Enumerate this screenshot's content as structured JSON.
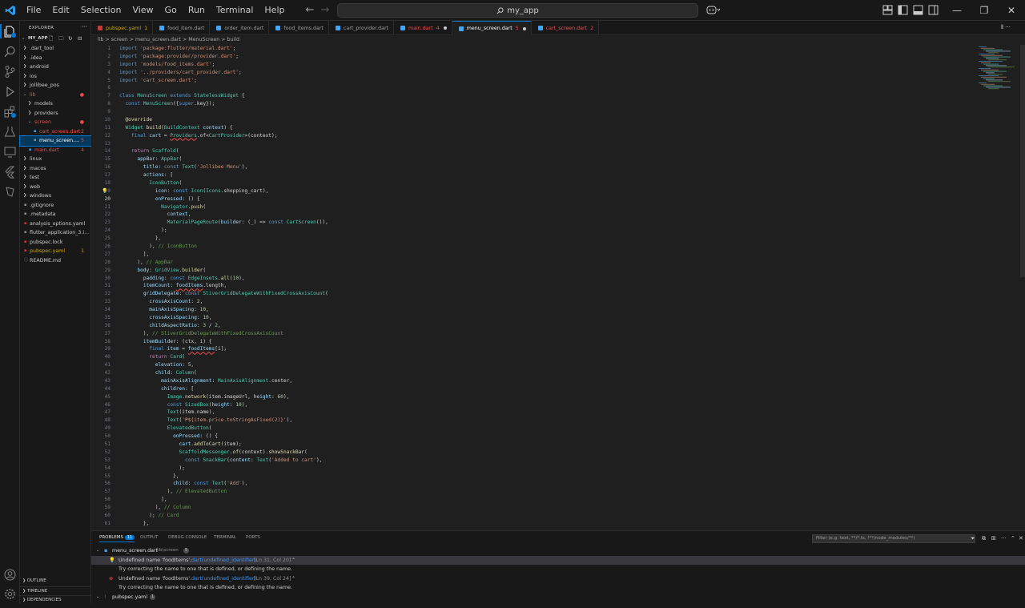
{
  "menu": [
    "File",
    "Edit",
    "Selection",
    "View",
    "Go",
    "Run",
    "Terminal",
    "Help"
  ],
  "search": {
    "text": "my_app"
  },
  "explorer": {
    "title": "EXPLORER",
    "project": "MY_APP",
    "items": [
      {
        "label": ".dart_tool",
        "depth": 1,
        "kind": "folder",
        "badge": "",
        "color": "#cccccc"
      },
      {
        "label": ".idea",
        "depth": 1,
        "kind": "folder",
        "badge": "",
        "color": "#cccccc"
      },
      {
        "label": "android",
        "depth": 1,
        "kind": "folder",
        "badge": "",
        "color": "#cccccc"
      },
      {
        "label": "ios",
        "depth": 1,
        "kind": "folder",
        "badge": "",
        "color": "#cccccc"
      },
      {
        "label": "jollibee_pos",
        "depth": 1,
        "kind": "folder",
        "badge": "",
        "color": "#cccccc"
      },
      {
        "label": "lib",
        "depth": 1,
        "kind": "open",
        "badge": "●",
        "color": "#f14c4c"
      },
      {
        "label": "models",
        "depth": 2,
        "kind": "folder",
        "badge": "",
        "color": "#cccccc"
      },
      {
        "label": "providers",
        "depth": 2,
        "kind": "folder",
        "badge": "",
        "color": "#cccccc"
      },
      {
        "label": "screen",
        "depth": 2,
        "kind": "open",
        "badge": "●",
        "color": "#f14c4c"
      },
      {
        "label": "cart_screen.dart",
        "depth": 3,
        "kind": "file",
        "badge": "2",
        "color": "#f14c4c"
      },
      {
        "label": "menu_screen....",
        "depth": 3,
        "kind": "file",
        "badge": "5",
        "color": "#ffffff"
      },
      {
        "label": "main.dart",
        "depth": 2,
        "kind": "file",
        "badge": "4",
        "color": "#f14c4c"
      },
      {
        "label": "linux",
        "depth": 1,
        "kind": "folder",
        "badge": "",
        "color": "#cccccc"
      },
      {
        "label": "macos",
        "depth": 1,
        "kind": "folder",
        "badge": "",
        "color": "#cccccc"
      },
      {
        "label": "test",
        "depth": 1,
        "kind": "folder",
        "badge": "",
        "color": "#cccccc"
      },
      {
        "label": "web",
        "depth": 1,
        "kind": "folder",
        "badge": "",
        "color": "#cccccc"
      },
      {
        "label": "windows",
        "depth": 1,
        "kind": "folder",
        "badge": "",
        "color": "#cccccc"
      },
      {
        "label": ".gitignore",
        "depth": 1,
        "kind": "file",
        "badge": "",
        "color": "#cccccc"
      },
      {
        "label": ".metadata",
        "depth": 1,
        "kind": "file",
        "badge": "",
        "color": "#cccccc"
      },
      {
        "label": "analysis_options.yaml",
        "depth": 1,
        "kind": "file",
        "badge": "",
        "color": "#cccccc"
      },
      {
        "label": "flutter_application_3.i...",
        "depth": 1,
        "kind": "file",
        "badge": "",
        "color": "#cccccc"
      },
      {
        "label": "pubspec.lock",
        "depth": 1,
        "kind": "file",
        "badge": "",
        "color": "#cccccc"
      },
      {
        "label": "pubspec.yaml",
        "depth": 1,
        "kind": "file",
        "badge": "1",
        "color": "#cca700"
      },
      {
        "label": "README.md",
        "depth": 1,
        "kind": "file",
        "badge": "",
        "color": "#cccccc"
      }
    ],
    "bottom": [
      "OUTLINE",
      "TIMELINE",
      "DEPENDENCIES"
    ]
  },
  "tabs": [
    {
      "label": "pubspec.yaml",
      "badge": "1",
      "color": "#cca700",
      "icon": "#cb3837",
      "active": false,
      "dirty": false
    },
    {
      "label": "food_item.dart",
      "badge": "",
      "color": "#9d9d9d",
      "icon": "#42a5f5",
      "active": false,
      "dirty": false
    },
    {
      "label": "order_item.dart",
      "badge": "",
      "color": "#9d9d9d",
      "icon": "#42a5f5",
      "active": false,
      "dirty": false
    },
    {
      "label": "food_items.dart",
      "badge": "",
      "color": "#9d9d9d",
      "icon": "#42a5f5",
      "active": false,
      "dirty": false
    },
    {
      "label": "cart_provider.dart",
      "badge": "",
      "color": "#9d9d9d",
      "icon": "#42a5f5",
      "active": false,
      "dirty": false
    },
    {
      "label": "main.dart",
      "badge": "4",
      "color": "#f14c4c",
      "icon": "#42a5f5",
      "active": false,
      "dirty": true
    },
    {
      "label": "menu_screen.dart",
      "badge": "5",
      "color": "#f14c4c",
      "icon": "#42a5f5",
      "active": true,
      "dirty": true
    },
    {
      "label": "cart_screen.dart",
      "badge": "2",
      "color": "#f14c4c",
      "icon": "#42a5f5",
      "active": false,
      "dirty": false
    }
  ],
  "breadcrumb": "lib > screen > menu_screen.dart > MenuScreen > build",
  "current_line": 20,
  "code_lines": [
    [
      [
        "kw",
        "import "
      ],
      [
        "str",
        "'package:flutter/material.dart'"
      ],
      [
        "",
        "; "
      ]
    ],
    [
      [
        "kw",
        "import "
      ],
      [
        "str",
        "'package:provider/provider.dart'"
      ],
      [
        "",
        ";"
      ]
    ],
    [
      [
        "kw",
        "import "
      ],
      [
        "str",
        "'models/food_items.dart'"
      ],
      [
        "",
        ";"
      ]
    ],
    [
      [
        "kw",
        "import "
      ],
      [
        "str",
        "'../providers/cart_provider.dart'"
      ],
      [
        "",
        ";"
      ]
    ],
    [
      [
        "kw",
        "import "
      ],
      [
        "str",
        "'cart_screen.dart'"
      ],
      [
        "",
        ";"
      ]
    ],
    [],
    [
      [
        "kw",
        "class "
      ],
      [
        "cls",
        "MenuScreen "
      ],
      [
        "kw",
        "extends "
      ],
      [
        "cls",
        "StatelessWidget "
      ],
      [
        "",
        "{"
      ]
    ],
    [
      [
        "",
        "  "
      ],
      [
        "kw",
        "const "
      ],
      [
        "cls",
        "MenuScreen"
      ],
      [
        "",
        "({"
      ],
      [
        "kw",
        "super"
      ],
      [
        "",
        ".key});"
      ]
    ],
    [],
    [
      [
        "",
        "  "
      ],
      [
        "fn",
        "@override"
      ]
    ],
    [
      [
        "",
        "  "
      ],
      [
        "cls",
        "Widget "
      ],
      [
        "fn",
        "build"
      ],
      [
        "",
        "("
      ],
      [
        "cls",
        "BuildContext "
      ],
      [
        "var",
        "context"
      ],
      [
        "",
        ") {"
      ]
    ],
    [
      [
        "",
        "    "
      ],
      [
        "kw",
        "final "
      ],
      [
        "var",
        "cart "
      ],
      [
        "",
        "= "
      ],
      [
        "cls",
        "Providers"
      ],
      [
        "",
        ".of<"
      ],
      [
        "cls",
        "CartProvider"
      ],
      [
        "",
        ">(context);"
      ]
    ],
    [],
    [
      [
        "",
        "    "
      ],
      [
        "kw2",
        "return "
      ],
      [
        "cls",
        "Scaffold"
      ],
      [
        "",
        "("
      ]
    ],
    [
      [
        "",
        "      "
      ],
      [
        "var",
        "appBar"
      ],
      [
        "",
        ": "
      ],
      [
        "cls",
        "AppBar"
      ],
      [
        "",
        "("
      ]
    ],
    [
      [
        "",
        "        "
      ],
      [
        "var",
        "title"
      ],
      [
        "",
        ": "
      ],
      [
        "kw",
        "const "
      ],
      [
        "cls",
        "Text"
      ],
      [
        "",
        "("
      ],
      [
        "str",
        "'Jollibee Menu'"
      ],
      [
        "",
        "),"
      ]
    ],
    [
      [
        "",
        "        "
      ],
      [
        "var",
        "actions"
      ],
      [
        "",
        ": ["
      ]
    ],
    [
      [
        "",
        "          "
      ],
      [
        "cls",
        "IconButton"
      ],
      [
        "",
        "("
      ]
    ],
    [
      [
        "",
        "            "
      ],
      [
        "var",
        "icon"
      ],
      [
        "",
        ": "
      ],
      [
        "kw",
        "const "
      ],
      [
        "cls",
        "Icon"
      ],
      [
        "",
        "("
      ],
      [
        "cls",
        "Icons"
      ],
      [
        "",
        ".shopping_cart),"
      ]
    ],
    [
      [
        "",
        "            "
      ],
      [
        "var",
        "onPressed"
      ],
      [
        "",
        ": () {"
      ]
    ],
    [
      [
        "",
        "              "
      ],
      [
        "cls",
        "Navigator"
      ],
      [
        "",
        "."
      ],
      [
        "fn",
        "push"
      ],
      [
        "",
        "("
      ]
    ],
    [
      [
        "",
        "                "
      ],
      [
        "var",
        "context"
      ],
      [
        "",
        ","
      ]
    ],
    [
      [
        "",
        "                "
      ],
      [
        "cls",
        "MaterialPageRoute"
      ],
      [
        "",
        "("
      ],
      [
        "var",
        "builder"
      ],
      [
        "",
        ": (_) => "
      ],
      [
        "kw",
        "const "
      ],
      [
        "cls",
        "CartScreen"
      ],
      [
        "",
        "()),"
      ]
    ],
    [
      [
        "",
        "              );"
      ]
    ],
    [
      [
        "",
        "            },"
      ]
    ],
    [
      [
        "",
        "          ), "
      ],
      [
        "cmt",
        "// IconButton"
      ]
    ],
    [
      [
        "",
        "        ],"
      ]
    ],
    [
      [
        "",
        "      ), "
      ],
      [
        "cmt",
        "// AppBar"
      ]
    ],
    [
      [
        "",
        "      "
      ],
      [
        "var",
        "body"
      ],
      [
        "",
        ": "
      ],
      [
        "cls",
        "GridView"
      ],
      [
        "",
        "."
      ],
      [
        "fn",
        "builder"
      ],
      [
        "",
        "("
      ]
    ],
    [
      [
        "",
        "        "
      ],
      [
        "var",
        "padding"
      ],
      [
        "",
        ": "
      ],
      [
        "kw",
        "const "
      ],
      [
        "cls",
        "EdgeInsets"
      ],
      [
        "",
        "."
      ],
      [
        "fn",
        "all"
      ],
      [
        "",
        "("
      ],
      [
        "num",
        "10"
      ],
      [
        "",
        "),"
      ]
    ],
    [
      [
        "",
        "        "
      ],
      [
        "var",
        "itemCount"
      ],
      [
        "",
        ": "
      ],
      [
        "var",
        "foodItems"
      ],
      [
        "",
        ".length,"
      ]
    ],
    [
      [
        "",
        "        "
      ],
      [
        "var",
        "gridDelegate"
      ],
      [
        "",
        ": "
      ],
      [
        "kw",
        "const "
      ],
      [
        "cls",
        "SliverGridDelegateWithFixedCrossAxisCount"
      ],
      [
        "",
        "("
      ]
    ],
    [
      [
        "",
        "          "
      ],
      [
        "var",
        "crossAxisCount"
      ],
      [
        "",
        ": "
      ],
      [
        "num",
        "2"
      ],
      [
        "",
        ","
      ]
    ],
    [
      [
        "",
        "          "
      ],
      [
        "var",
        "mainAxisSpacing"
      ],
      [
        "",
        ": "
      ],
      [
        "num",
        "10"
      ],
      [
        "",
        ","
      ]
    ],
    [
      [
        "",
        "          "
      ],
      [
        "var",
        "crossAxisSpacing"
      ],
      [
        "",
        ": "
      ],
      [
        "num",
        "10"
      ],
      [
        "",
        ","
      ]
    ],
    [
      [
        "",
        "          "
      ],
      [
        "var",
        "childAspectRatio"
      ],
      [
        "",
        ": "
      ],
      [
        "num",
        "3 "
      ],
      [
        "",
        "/ "
      ],
      [
        "num",
        "2"
      ],
      [
        "",
        ","
      ]
    ],
    [
      [
        "",
        "        ), "
      ],
      [
        "cmt",
        "// SliverGridDelegateWithFixedCrossAxisCount"
      ]
    ],
    [
      [
        "",
        "        "
      ],
      [
        "var",
        "itemBuilder"
      ],
      [
        "",
        ": (ctx, i) {"
      ]
    ],
    [
      [
        "",
        "          "
      ],
      [
        "kw",
        "final "
      ],
      [
        "var",
        "item "
      ],
      [
        "",
        "= "
      ],
      [
        "var",
        "foodItems"
      ],
      [
        "",
        "[i];"
      ]
    ],
    [
      [
        "",
        "          "
      ],
      [
        "kw2",
        "return "
      ],
      [
        "cls",
        "Card"
      ],
      [
        "",
        "("
      ]
    ],
    [
      [
        "",
        "            "
      ],
      [
        "var",
        "elevation"
      ],
      [
        "",
        ": "
      ],
      [
        "num",
        "5"
      ],
      [
        "",
        ","
      ]
    ],
    [
      [
        "",
        "            "
      ],
      [
        "var",
        "child"
      ],
      [
        "",
        ": "
      ],
      [
        "cls",
        "Column"
      ],
      [
        "",
        "("
      ]
    ],
    [
      [
        "",
        "              "
      ],
      [
        "var",
        "mainAxisAlignment"
      ],
      [
        "",
        ": "
      ],
      [
        "cls",
        "MainAxisAlignment"
      ],
      [
        "",
        ".center,"
      ]
    ],
    [
      [
        "",
        "              "
      ],
      [
        "var",
        "children"
      ],
      [
        "",
        ": ["
      ]
    ],
    [
      [
        "",
        "                "
      ],
      [
        "cls",
        "Image"
      ],
      [
        "",
        "."
      ],
      [
        "fn",
        "network"
      ],
      [
        "",
        "(item.imageUrl, "
      ],
      [
        "var",
        "height"
      ],
      [
        "",
        ": "
      ],
      [
        "num",
        "60"
      ],
      [
        "",
        "),"
      ]
    ],
    [
      [
        "",
        "                "
      ],
      [
        "kw",
        "const "
      ],
      [
        "cls",
        "SizedBox"
      ],
      [
        "",
        "("
      ],
      [
        "var",
        "height"
      ],
      [
        "",
        ": "
      ],
      [
        "num",
        "10"
      ],
      [
        "",
        "),"
      ]
    ],
    [
      [
        "",
        "                "
      ],
      [
        "cls",
        "Text"
      ],
      [
        "",
        "(item.name),"
      ]
    ],
    [
      [
        "",
        "                "
      ],
      [
        "cls",
        "Text"
      ],
      [
        "",
        "("
      ],
      [
        "str",
        "'₱${item.price.toStringAsFixed(2)}'"
      ],
      [
        "",
        "),"
      ]
    ],
    [
      [
        "",
        "                "
      ],
      [
        "cls",
        "ElevatedButton"
      ],
      [
        "",
        "("
      ]
    ],
    [
      [
        "",
        "                  "
      ],
      [
        "var",
        "onPressed"
      ],
      [
        "",
        ": () {"
      ]
    ],
    [
      [
        "",
        "                    "
      ],
      [
        "var",
        "cart"
      ],
      [
        "",
        "."
      ],
      [
        "fn",
        "addToCart"
      ],
      [
        "",
        "(item);"
      ]
    ],
    [
      [
        "",
        "                    "
      ],
      [
        "cls",
        "ScaffoldMessenger"
      ],
      [
        "",
        "."
      ],
      [
        "fn",
        "of"
      ],
      [
        "",
        "(context)."
      ],
      [
        "fn",
        "showSnackBar"
      ],
      [
        "",
        "("
      ]
    ],
    [
      [
        "",
        "                      "
      ],
      [
        "kw",
        "const "
      ],
      [
        "cls",
        "SnackBar"
      ],
      [
        "",
        "("
      ],
      [
        "var",
        "content"
      ],
      [
        "",
        ": "
      ],
      [
        "cls",
        "Text"
      ],
      [
        "",
        "("
      ],
      [
        "str",
        "'Added to cart'"
      ],
      [
        "",
        "),"
      ]
    ],
    [
      [
        "",
        "                    );"
      ]
    ],
    [
      [
        "",
        "                  },"
      ]
    ],
    [
      [
        "",
        "                  "
      ],
      [
        "var",
        "child"
      ],
      [
        "",
        ": "
      ],
      [
        "kw",
        "const "
      ],
      [
        "cls",
        "Text"
      ],
      [
        "",
        "("
      ],
      [
        "str",
        "'Add'"
      ],
      [
        "",
        "),"
      ]
    ],
    [
      [
        "",
        "                ), "
      ],
      [
        "cmt",
        "// ElevatedButton"
      ]
    ],
    [
      [
        "",
        "              ],"
      ]
    ],
    [
      [
        "",
        "            ), "
      ],
      [
        "cmt",
        "// Column"
      ]
    ],
    [
      [
        "",
        "          ); "
      ],
      [
        "cmt",
        "// Card"
      ]
    ],
    [
      [
        "",
        "        },"
      ]
    ]
  ],
  "panel": {
    "tabs": [
      "PROBLEMS",
      "OUTPUT",
      "DEBUG CONSOLE",
      "TERMINAL",
      "PORTS"
    ],
    "problem_count": "11",
    "filter_placeholder": "Filter (e.g. text, **/*.ts, !**/node_modules/**)",
    "rows": [
      {
        "kind": "file",
        "text": "menu_screen.dart",
        "path": "lib\\screen",
        "count": "5"
      },
      {
        "kind": "warning",
        "text": "Undefined name 'foodItems'.",
        "source": "dart(undefined_identifier)",
        "loc": "[Ln 31, Col 20]"
      },
      {
        "kind": "hint",
        "text": "Try correcting the name to one that is defined, or defining the name."
      },
      {
        "kind": "error",
        "text": "Undefined name 'foodItems'.",
        "source": "dart(undefined_identifier)",
        "loc": "[Ln 39, Col 24]"
      },
      {
        "kind": "hint",
        "text": "Try correcting the name to one that is defined, or defining the name."
      },
      {
        "kind": "file2",
        "text": "pubspec.yaml",
        "path": "",
        "count": "1"
      }
    ]
  }
}
